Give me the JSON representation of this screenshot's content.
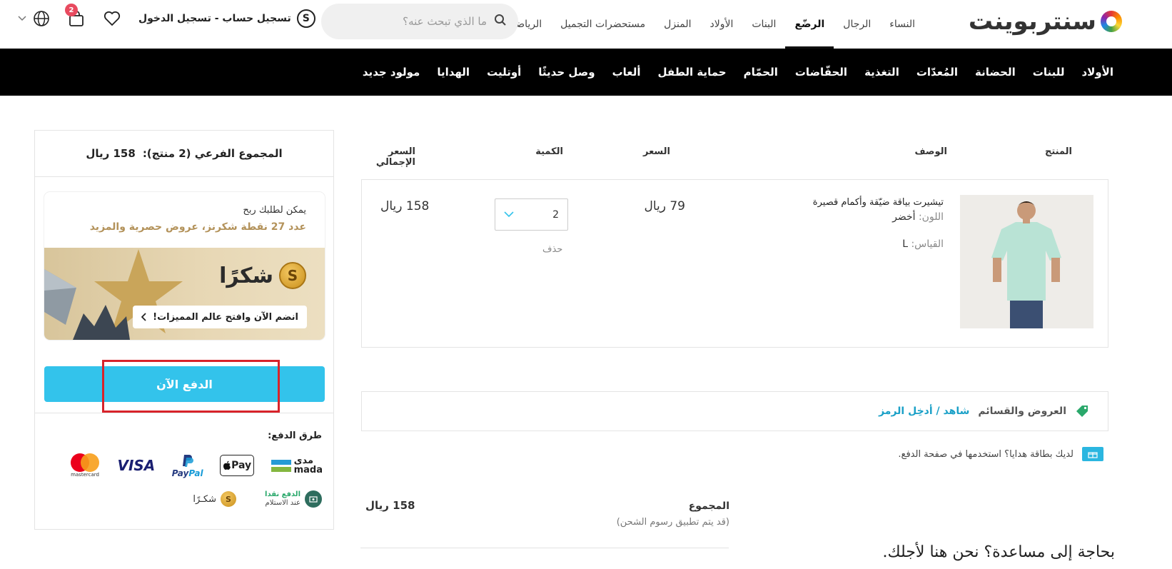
{
  "header": {
    "logo_text": "سنتربوينت",
    "departments": [
      {
        "label": "النساء",
        "active": false
      },
      {
        "label": "الرجال",
        "active": false
      },
      {
        "label": "الرضّع",
        "active": true
      },
      {
        "label": "البنات",
        "active": false
      },
      {
        "label": "الأولاد",
        "active": false
      },
      {
        "label": "المنزل",
        "active": false
      },
      {
        "label": "مستحضرات التجميل",
        "active": false
      },
      {
        "label": "الرياضة",
        "active": false
      }
    ],
    "search_placeholder": "ما الذي تبحث عنه؟",
    "account_label": "تسجيل حساب - تسجيل الدخول",
    "account_coin": "S",
    "cart_count": "2"
  },
  "categories": [
    "الأولاد",
    "للبنات",
    "الحضانة",
    "المُعدّات",
    "التغذية",
    "الحفّاضات",
    "الحمّام",
    "حماية الطفل",
    "ألعاب",
    "وصل حديثًا",
    "أوتليت",
    "الهدايا",
    "مولود جديد"
  ],
  "cart": {
    "columns": {
      "product": "المنتج",
      "description": "الوصف",
      "price": "السعر",
      "quantity": "الكمية",
      "total": "السعر الإجمالي"
    },
    "item": {
      "title": "تيشيرت بياقة ضيّقة وأكمام قصيرة",
      "color_label": "اللون:",
      "color_value": "أخضر",
      "size_label": "القياس:",
      "size_value": "L",
      "price": "79 ريال",
      "quantity": "2",
      "total": "158 ريال",
      "remove_label": "حذف"
    },
    "promo_label": "العروض والقسائم",
    "promo_link": "شاهد / أدخِل الرمز",
    "gift_note": "لديك بطاقة هدايا؟ استخدمها في صفحة الدفع.",
    "total_label": "المجموع",
    "total_sub": "(قد يتم تطبيق رسوم الشحن)",
    "total_value": "158 ريال",
    "help_text": "بحاجة إلى مساعدة؟ نحن هنا لأجلك."
  },
  "summary": {
    "subtotal_label": "المجموع الفرعي (2 منتج):",
    "subtotal_value": "158 ريال",
    "reward_line1": "يمكن لطلبك ربح",
    "reward_line2": "عدد 27 نقطة شكرنز، عروض حصرية والمزيد",
    "shokran_word": "شكرًا",
    "shokran_coin": "S",
    "join_label": "انضم الآن وافتح عالم المميزات!",
    "pay_button": "الدفع الآن",
    "payment_methods_label": "طرق الدفع:",
    "logos": {
      "mada_ar": "مدى",
      "mada_en": "mada",
      "apple": "Pay",
      "paypal_1": "Pay",
      "paypal_2": "Pal",
      "visa": "VISA",
      "mastercard": "mastercard"
    },
    "cod_line1": "الدفع نقدا",
    "cod_line2": "عند الاستلام",
    "shokran_small": "شكـرًا"
  },
  "colors": {
    "accent": "#33c3eb",
    "gold": "#b3925a",
    "highlight": "#d8232a",
    "link": "#1aa0c7"
  }
}
